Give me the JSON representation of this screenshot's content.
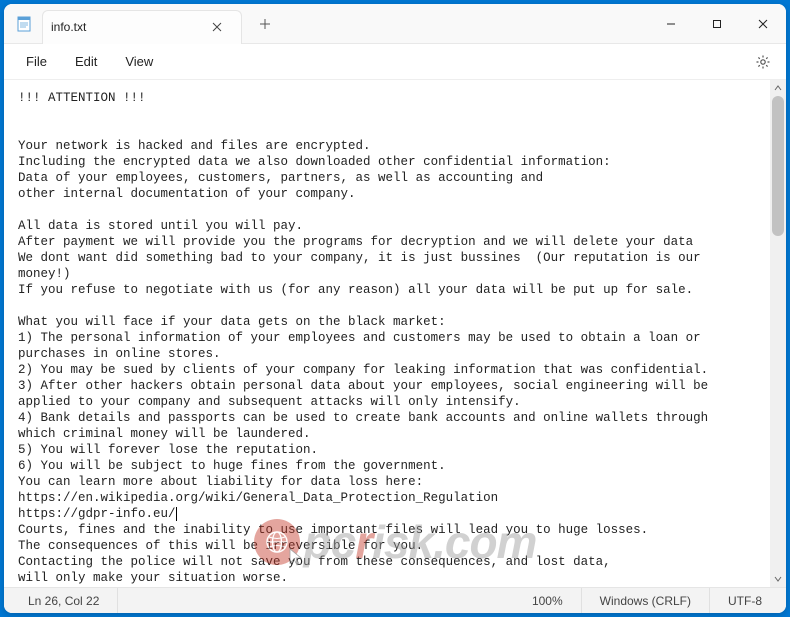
{
  "window": {
    "title": "info.txt",
    "tab_title": "info.txt"
  },
  "menu": {
    "file": "File",
    "edit": "Edit",
    "view": "View"
  },
  "text": {
    "l1": "!!! ATTENTION !!!",
    "l2": "",
    "l3": "",
    "l4": "Your network is hacked and files are encrypted.",
    "l5": "Including the encrypted data we also downloaded other confidential information:",
    "l6": "Data of your employees, customers, partners, as well as accounting and",
    "l7": "other internal documentation of your company.",
    "l8": "",
    "l9": "All data is stored until you will pay.",
    "l10": "After payment we will provide you the programs for decryption and we will delete your data",
    "l11": "We dont want did something bad to your company, it is just bussines  (Our reputation is our money!)",
    "l12": "If you refuse to negotiate with us (for any reason) all your data will be put up for sale.",
    "l13": "",
    "l14": "What you will face if your data gets on the black market:",
    "l15": "1) The personal information of your employees and customers may be used to obtain a loan or",
    "l16": "purchases in online stores.",
    "l17": "2) You may be sued by clients of your company for leaking information that was confidential.",
    "l18": "3) After other hackers obtain personal data about your employees, social engineering will be",
    "l19": "applied to your company and subsequent attacks will only intensify.",
    "l20": "4) Bank details and passports can be used to create bank accounts and online wallets through",
    "l21": "which criminal money will be laundered.",
    "l22": "5) You will forever lose the reputation.",
    "l23": "6) You will be subject to huge fines from the government.",
    "l24": "You can learn more about liability for data loss here:",
    "l25": "https://en.wikipedia.org/wiki/General_Data_Protection_Regulation",
    "l26a": "https://gdpr-info.eu/",
    "l27": "Courts, fines and the inability to use important files will lead you to huge losses.",
    "l28": "The consequences of this will be irreversible for you.",
    "l29": "Contacting the police will not save you from these consequences, and lost data,",
    "l30": "will only make your situation worse."
  },
  "status": {
    "position": "Ln 26, Col 22",
    "zoom": "100%",
    "lineending": "Windows (CRLF)",
    "encoding": "UTF-8"
  },
  "watermark": {
    "pc": "pc",
    "r": "r",
    "rest": "isk.com"
  }
}
